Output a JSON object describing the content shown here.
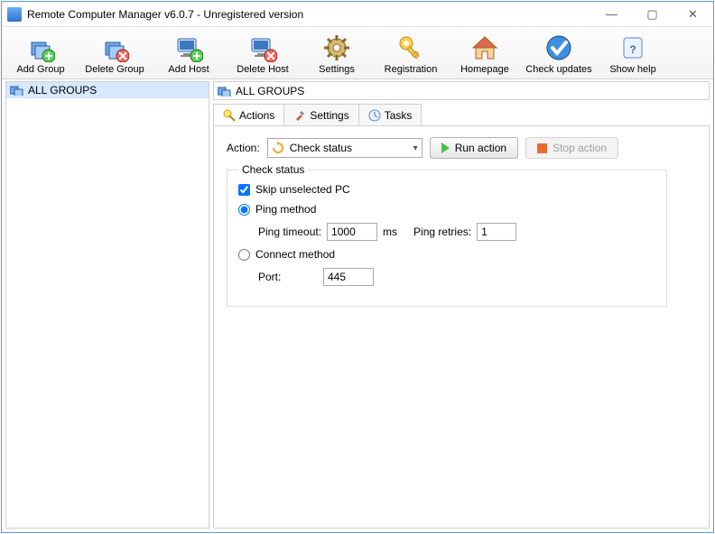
{
  "window": {
    "title": "Remote Computer Manager v6.0.7 - Unregistered version"
  },
  "toolbar": {
    "add_group": "Add Group",
    "delete_group": "Delete Group",
    "add_host": "Add Host",
    "delete_host": "Delete Host",
    "settings": "Settings",
    "registration": "Registration",
    "homepage": "Homepage",
    "check_updates": "Check updates",
    "show_help": "Show help"
  },
  "tree": {
    "root": "ALL GROUPS"
  },
  "content": {
    "header": "ALL GROUPS",
    "tabs": {
      "actions": "Actions",
      "settings": "Settings",
      "tasks": "Tasks"
    },
    "action_label": "Action:",
    "action_selected": "Check status",
    "run_action": "Run action",
    "stop_action": "Stop action",
    "fieldset": {
      "legend": "Check status",
      "skip": "Skip unselected PC",
      "ping": "Ping method",
      "ping_timeout_label": "Ping timeout:",
      "ping_timeout_val": "1000",
      "ping_timeout_unit": "ms",
      "ping_retries_label": "Ping retries:",
      "ping_retries_val": "1",
      "connect": "Connect method",
      "port_label": "Port:",
      "port_val": "445"
    }
  }
}
